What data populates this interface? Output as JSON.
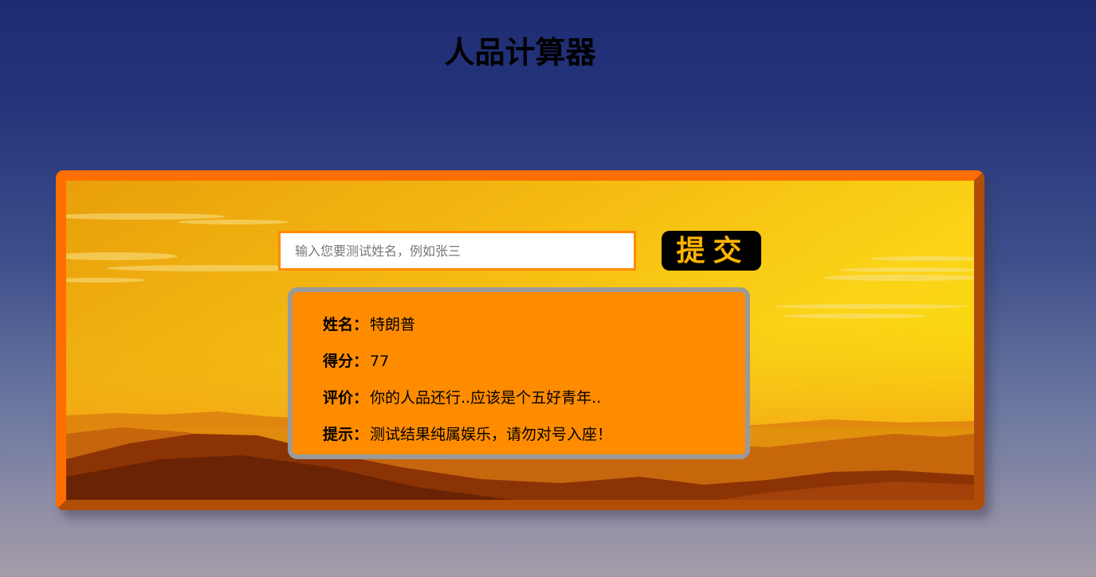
{
  "page": {
    "title": "人品计算器"
  },
  "form": {
    "input_placeholder": "输入您要测试姓名，例如张三",
    "input_value": "",
    "submit_label": "提交"
  },
  "result": {
    "rows": [
      {
        "label": "姓名：",
        "value": "特朗普"
      },
      {
        "label": "得分：",
        "value": "77"
      },
      {
        "label": "评价：",
        "value": "你的人品还行..应该是个五好青年.."
      },
      {
        "label": "提示：",
        "value": "测试结果纯属娱乐，请勿对号入座！"
      }
    ]
  },
  "colors": {
    "card_border": "#ff6e00",
    "submit_bg": "#000000",
    "submit_text": "#ffb400",
    "result_bg": "#ff8c00",
    "result_border": "#9a9a9a",
    "input_border": "#ff8a00"
  }
}
